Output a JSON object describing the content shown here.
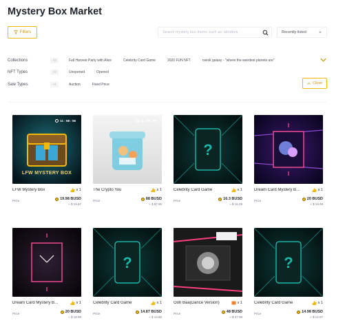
{
  "page": {
    "title": "Mystery Box Market"
  },
  "toolbar": {
    "filters_label": "Filters",
    "search_placeholder": "Search mystery box theme such as: blindbox",
    "sort_label": "Recently listed",
    "close_label": "Close"
  },
  "filters": {
    "collections": {
      "label": "Collections",
      "all": "All",
      "options": [
        "Fall Harvest Party with Alice",
        "Celebrity Card Game",
        "2020 FUN NFT",
        "ovinik galaxy - \"where the weirdest planets are\""
      ]
    },
    "nft_types": {
      "label": "NFT Types",
      "all": "All",
      "options": [
        "Unopened",
        "Opened"
      ]
    },
    "sale_types": {
      "label": "Sale Types",
      "all": "All",
      "options": [
        "Auction",
        "Fixed Price"
      ]
    }
  },
  "cards": [
    {
      "name": "LFW Mystery Box",
      "qty": "x 1",
      "price_label": "Price",
      "price": "19.98 BUSD",
      "usd": "≈ $ 19.97",
      "timer": "11 : 58 : 56",
      "art": "LFW MYSTERY BOX"
    },
    {
      "name": "The Crypto You",
      "qty": "x 1",
      "price_label": "Price",
      "price": "88 BUSD",
      "usd": "≈ $ 87.96",
      "timer": "11 : 58 : 56"
    },
    {
      "name": "Celebrity Card Game",
      "qty": "x 1",
      "price_label": "Price",
      "price": "16.3 BUSD",
      "usd": "≈ $ 16.29"
    },
    {
      "name": "Dream Card Mystery B...",
      "qty": "x 1",
      "price_label": "Price",
      "price": "20 BUSD",
      "usd": "≈ $ 19.99"
    },
    {
      "name": "Dream Card Mystery B...",
      "qty": "x 1",
      "price_label": "Price",
      "price": "20 BUSD",
      "usd": "≈ $ 19.99"
    },
    {
      "name": "Celebrity Card Game",
      "qty": "x 1",
      "price_label": "Price",
      "price": "14.87 BUSD",
      "usd": "≈ $ 14.86"
    },
    {
      "name": "Ooh Baa(Dance Version)",
      "qty": "x 1",
      "price_label": "Price",
      "price": "48 BUSD",
      "usd": "≈ $ 47.98"
    },
    {
      "name": "Celebrity Card Game",
      "qty": "x 1",
      "price_label": "Price",
      "price": "14.98 BUSD",
      "usd": "≈ $ 14.97"
    }
  ],
  "colors": {
    "accent": "#f0b90b",
    "accent_text": "#c99400",
    "text": "#1e2329",
    "muted": "#707a8a"
  }
}
